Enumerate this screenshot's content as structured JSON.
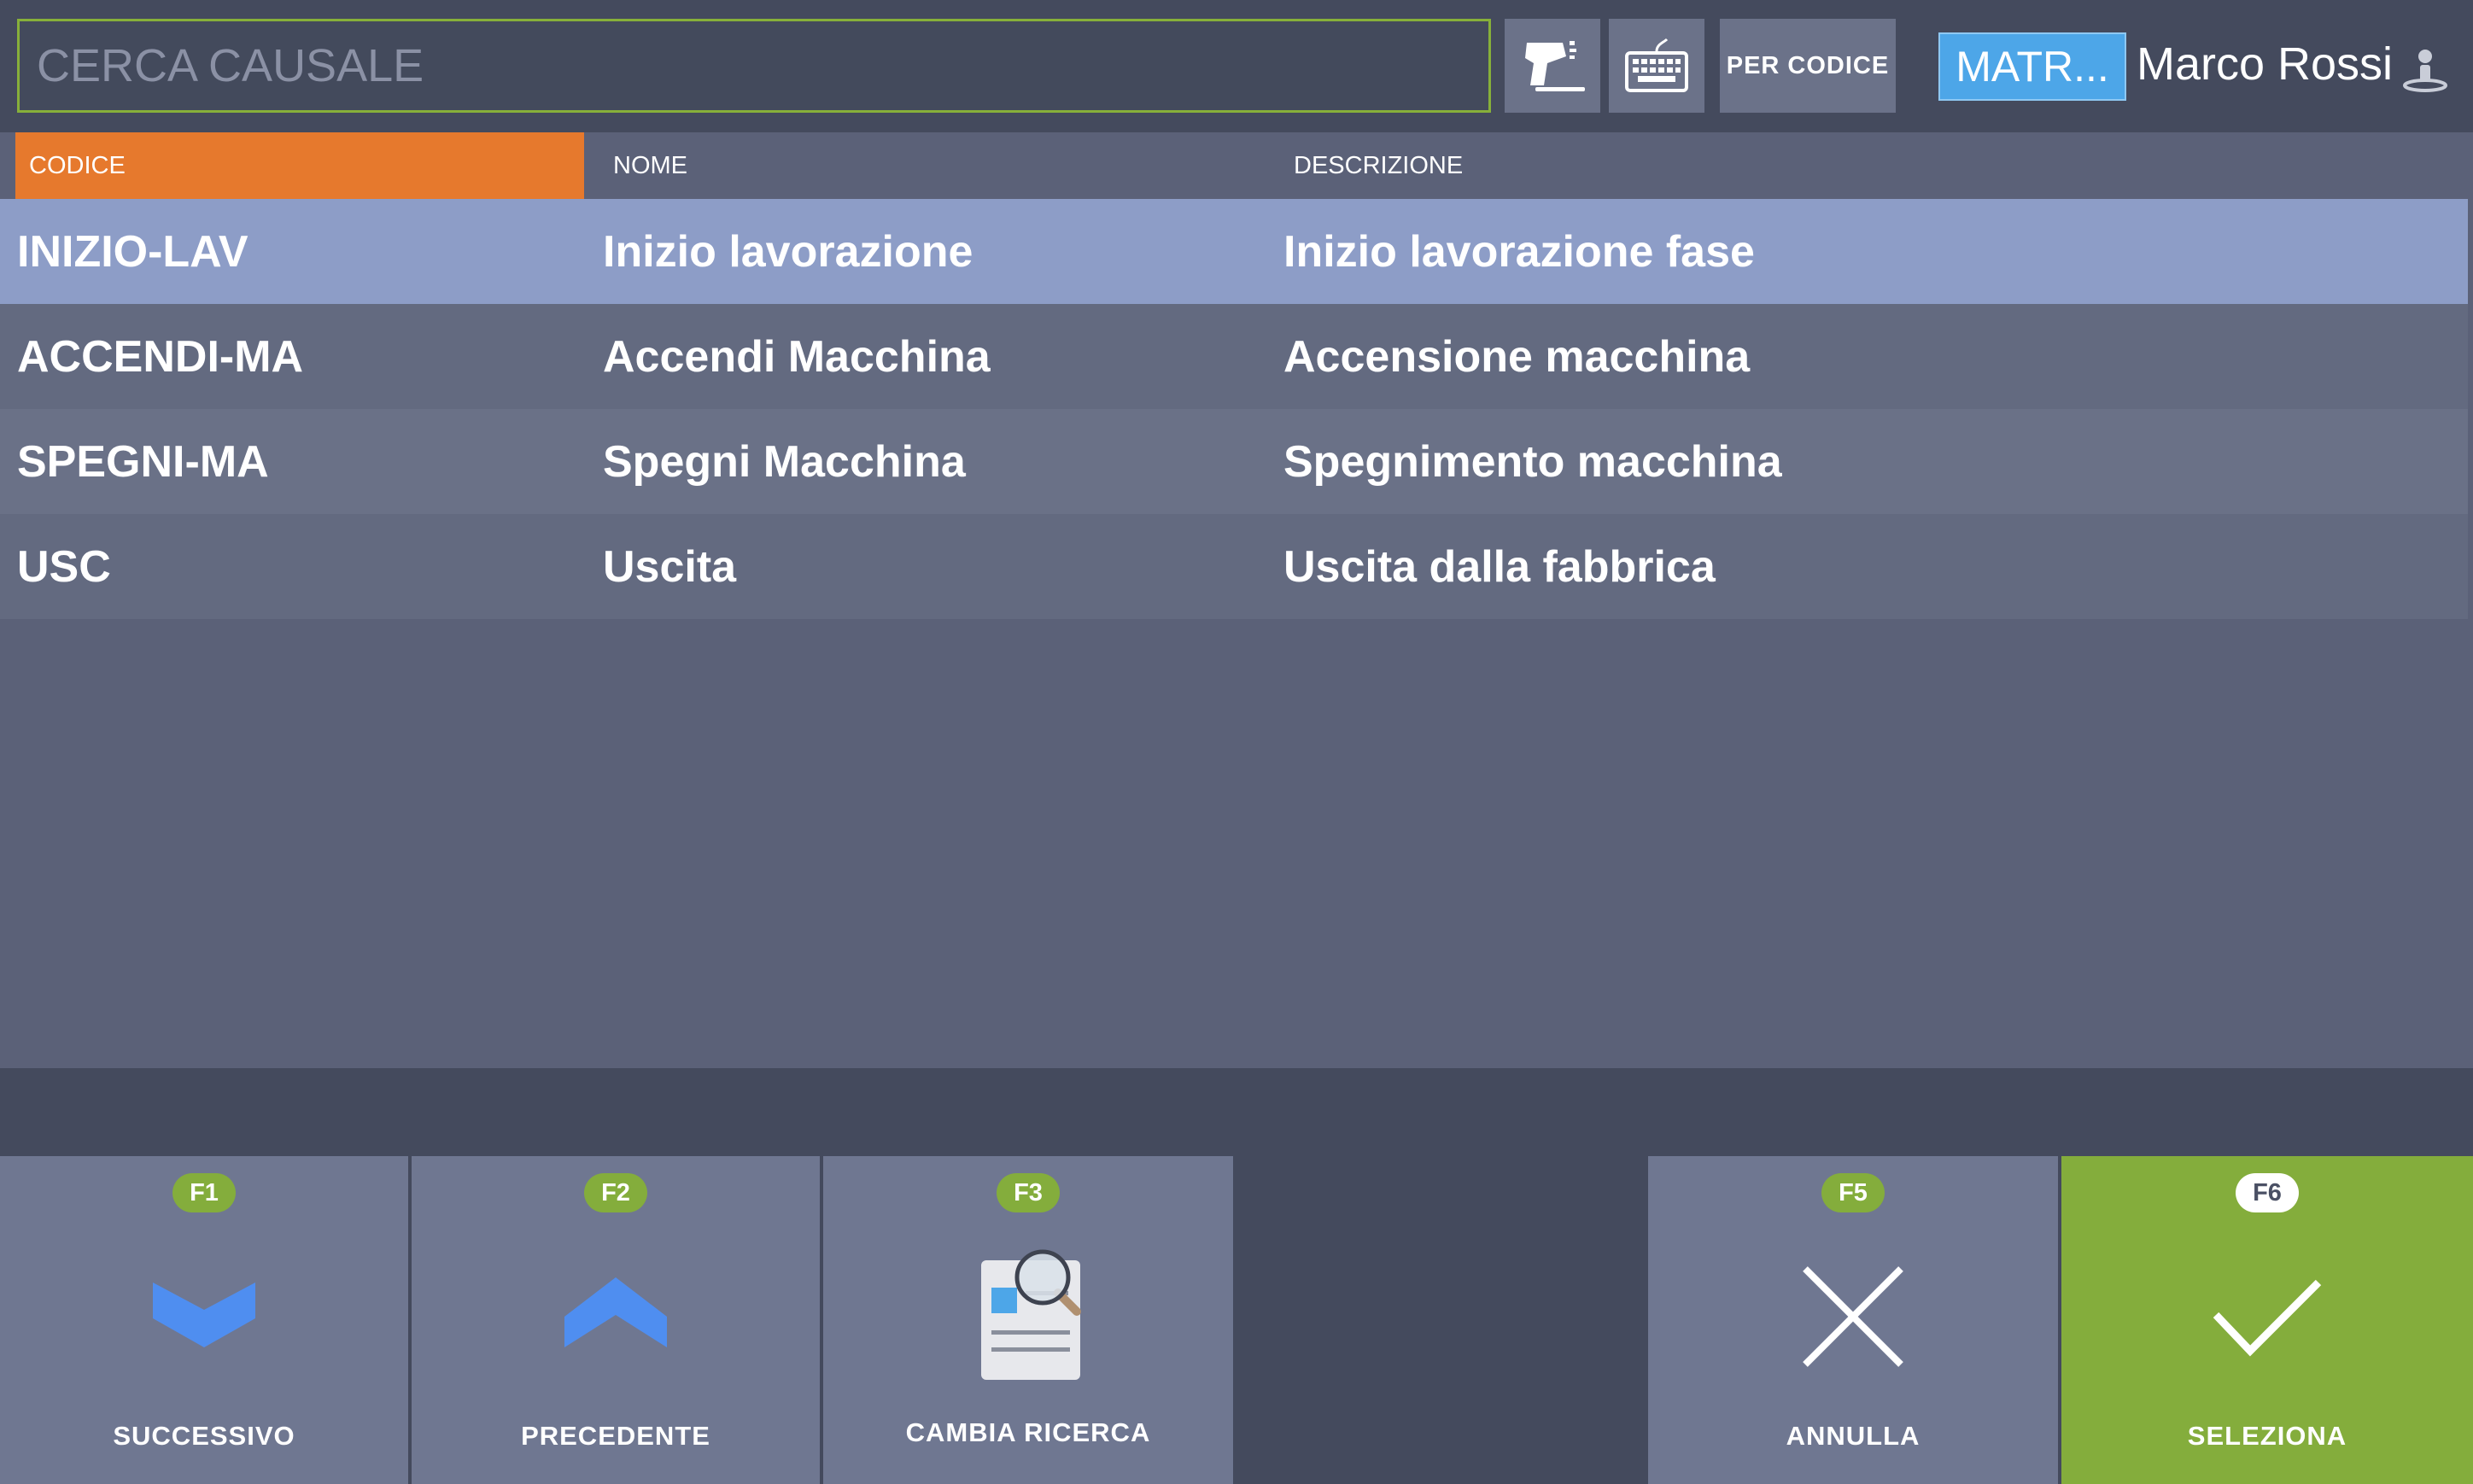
{
  "search": {
    "placeholder": "CERCA CAUSALE",
    "value": ""
  },
  "toolbar": {
    "scanner_icon": "barcode-scanner-icon",
    "keyboard_icon": "keyboard-icon",
    "per_codice_label": "PER CODICE",
    "matricola_label": "MATR...",
    "user_name": "Marco Rossi",
    "user_icon": "user-icon"
  },
  "table": {
    "columns": [
      "CODICE",
      "NOME",
      "DESCRIZIONE"
    ],
    "sorted_column": "CODICE",
    "selected_row": 0,
    "rows": [
      {
        "codice": "INIZIO-LAV",
        "nome": "Inizio lavorazione",
        "descrizione": "Inizio lavorazione fase"
      },
      {
        "codice": "ACCENDI-MA",
        "nome": "Accendi Macchina",
        "descrizione": "Accensione macchina"
      },
      {
        "codice": "SPEGNI-MA",
        "nome": "Spegni Macchina",
        "descrizione": "Spegnimento macchina"
      },
      {
        "codice": "USC",
        "nome": "Uscita",
        "descrizione": "Uscita dalla fabbrica"
      }
    ]
  },
  "function_keys": [
    {
      "key": "F1",
      "label": "SUCCESSIVO",
      "icon": "chevron-down-icon"
    },
    {
      "key": "F2",
      "label": "PRECEDENTE",
      "icon": "chevron-up-icon"
    },
    {
      "key": "F3",
      "label": "CAMBIA RICERCA",
      "icon": "document-search-icon"
    },
    {
      "key": "F5",
      "label": "ANNULLA",
      "icon": "close-icon"
    },
    {
      "key": "F6",
      "label": "SELEZIONA",
      "icon": "check-icon"
    }
  ],
  "colors": {
    "accent_green": "#84ad3c",
    "sort_header": "#e6792d",
    "selected_row": "#8d9dc7",
    "matr_button": "#4da6e8"
  }
}
